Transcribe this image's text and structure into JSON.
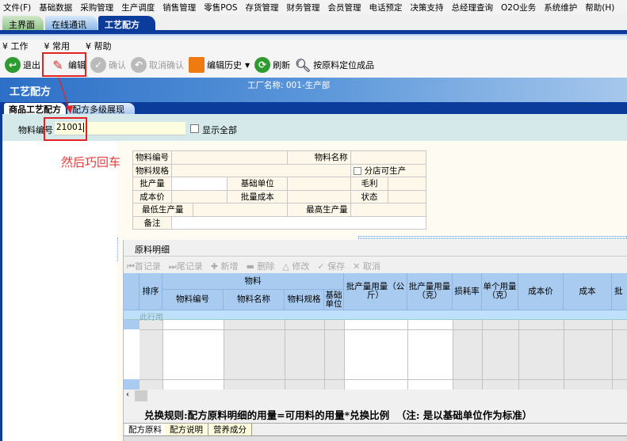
{
  "menu": [
    "文件(F)",
    "基础数据",
    "采购管理",
    "生产调度",
    "销售管理",
    "零售POS",
    "存货管理",
    "财务管理",
    "会员管理",
    "电话预定",
    "决策支持",
    "总经理查询",
    "O2O业务",
    "系统维护",
    "帮助(H)"
  ],
  "main_tabs": [
    "主界面",
    "在线通讯",
    "工艺配方"
  ],
  "submenu": [
    "工作",
    "常用",
    "帮助"
  ],
  "toolbar": {
    "exit": "退出",
    "edit": "编辑",
    "confirm": "确认",
    "cancel_confirm": "取消确认",
    "edit_history": "编辑历史",
    "refresh": "刷新",
    "locate": "按原料定位成品"
  },
  "header": {
    "title": "工艺配方",
    "factory": "工厂名称: 001-生产部"
  },
  "sub_tabs": [
    "商品工艺配方",
    "配方多级展现"
  ],
  "filter": {
    "label": "物料编号",
    "value": "21001",
    "show_all": "显示全部"
  },
  "annotation": "然后巧回车",
  "form": {
    "code": "物料编号",
    "name": "物料名称",
    "spec": "物料规格",
    "branch": "分店可生产",
    "batch": "批产量",
    "base_unit": "基础单位",
    "gross": "毛利",
    "cost_price": "成本价",
    "batch_cost": "批量成本",
    "status": "状态",
    "min": "最低生产量",
    "max": "最高生产量",
    "note": "备注"
  },
  "grid": {
    "title": "原料明细",
    "nav": [
      "首记录",
      "尾记录",
      "新增",
      "删除",
      "修改",
      "保存",
      "取消"
    ],
    "group": "物料",
    "columns": [
      "排序",
      "物料编号",
      "物料名称",
      "物料规格",
      "基础单位",
      "批产量用量（公斤）",
      "批产量用量（克）",
      "损耗率",
      "单个用量（克）",
      "成本价",
      "成本",
      "批"
    ],
    "filter_row": "此行用",
    "rule": "兑换规则:配方原料明细的用量=可用料的用量*兑换比例  （注: 是以基础单位作为标准）",
    "bottom_tabs": [
      "配方原料",
      "配方说明",
      "营养成分"
    ]
  }
}
